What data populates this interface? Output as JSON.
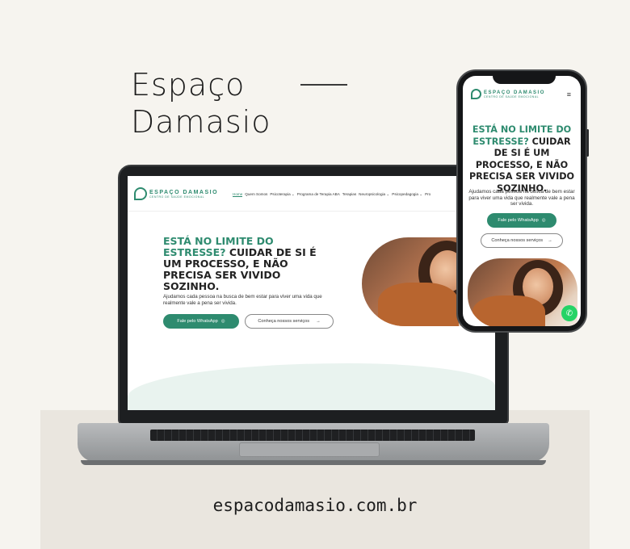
{
  "brand": {
    "line1": "Espaço",
    "line2": "Damasio"
  },
  "domain": "espacodamasio.com.br",
  "site": {
    "logo_text": "ESPAÇO DAMASIO",
    "logo_sub": "CENTRO DE SAÚDE EMOCIONAL",
    "nav": [
      "Home",
      "Quem Somos",
      "Psicoterapia ⌄",
      "Programa de Terapia ABA",
      "Terapias",
      "Neuropsicologia ⌄",
      "Psicopedagogia ⌄",
      "Pro"
    ],
    "hero_title_accent": "ESTÁ NO LIMITE DO ESTRESSE?",
    "hero_title_rest": "CUIDAR DE SI É UM PROCESSO, E NÃO PRECISA SER VIVIDO SOZINHO.",
    "hero_subtitle": "Ajudamos cada pessoa na busca de bem estar para viver uma vida que realmente vale a pena ser vivida.",
    "cta_whatsapp": "Fale pelo WhatsApp",
    "cta_services": "Conheça nossos serviços",
    "menu_icon": "≡"
  },
  "icons": {
    "whatsapp": "whatsapp-icon",
    "arrow": "arrow-right-icon",
    "menu": "hamburger-icon"
  },
  "colors": {
    "accent": "#2e8b6f",
    "background": "#f6f4ef",
    "band": "#eae6df",
    "whatsapp": "#25d366"
  }
}
